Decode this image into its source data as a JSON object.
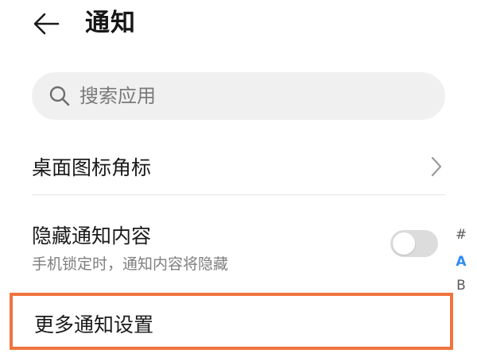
{
  "header": {
    "title": "通知",
    "back_icon": "back-arrow-icon"
  },
  "search": {
    "placeholder": "搜索应用",
    "icon": "search-icon"
  },
  "rows": {
    "badge": {
      "title": "桌面图标角标",
      "icon": "chevron-right-icon"
    },
    "hide_content": {
      "title": "隐藏通知内容",
      "subtitle": "手机锁定时，通知内容将隐藏",
      "toggle_on": false
    },
    "more_settings": {
      "title": "更多通知设置",
      "highlight_color": "#f0743e"
    }
  },
  "index_bar": {
    "items": [
      "#",
      "A",
      "B"
    ],
    "active": "A",
    "active_color": "#2f8cf0"
  }
}
